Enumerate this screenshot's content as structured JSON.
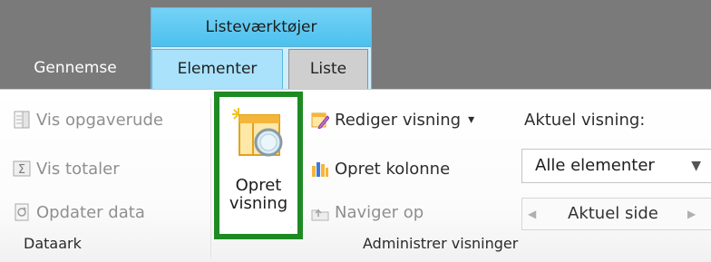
{
  "tabs": {
    "context_group_title": "Listeværktøjer",
    "browse": "Gennemse",
    "items": "Elementer",
    "list": "Liste"
  },
  "datasheet_group": {
    "label": "Dataark",
    "task_pane": "Vis opgaverude",
    "totals": "Vis totaler",
    "refresh": "Opdater data"
  },
  "create_view": {
    "line1": "Opret",
    "line2": "visning"
  },
  "manage_views_group": {
    "label": "Administrer visninger",
    "modify_view": "Rediger visning",
    "modify_view_arrow": "▾",
    "create_column": "Opret kolonne",
    "navigate_up": "Naviger op"
  },
  "current_view": {
    "label": "Aktuel visning:",
    "selected": "Alle elementer",
    "arrow": "▼"
  },
  "pager": {
    "label": "Aktuel side",
    "prev": "◀",
    "next": "▶"
  },
  "colors": {
    "header_band": "#7a7a7a",
    "context_tab": "#4cc0ee",
    "highlight_border": "#1e8a23"
  }
}
